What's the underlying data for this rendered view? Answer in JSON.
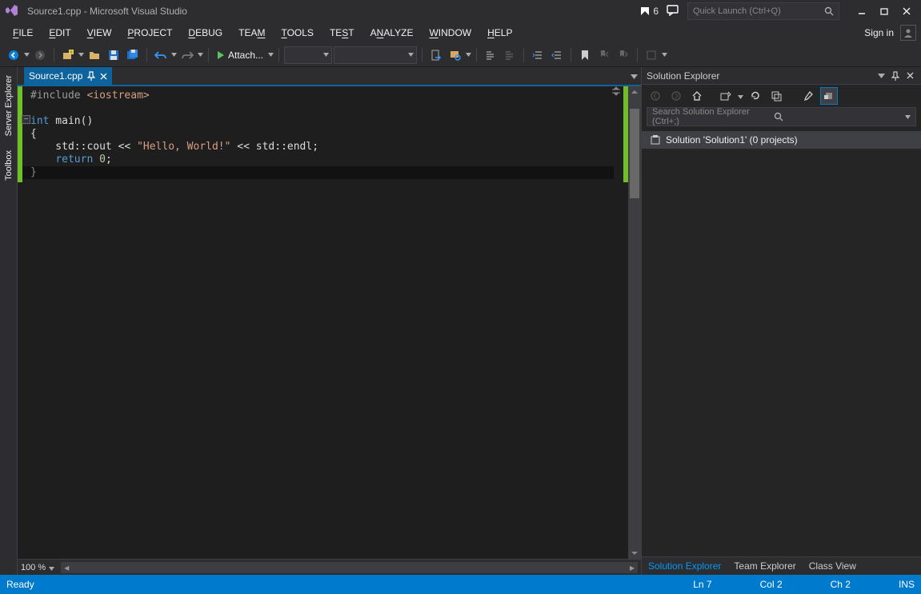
{
  "titlebar": {
    "title": "Source1.cpp - Microsoft Visual Studio",
    "notifications_count": "6",
    "quicklaunch_placeholder": "Quick Launch (Ctrl+Q)"
  },
  "menu": {
    "file": "FILE",
    "edit": "EDIT",
    "view": "VIEW",
    "project": "PROJECT",
    "debug": "DEBUG",
    "team": "TEAM",
    "tools": "TOOLS",
    "test": "TEST",
    "analyze": "ANALYZE",
    "window": "WINDOW",
    "help": "HELP",
    "signin": "Sign in"
  },
  "toolbar": {
    "attach_label": "Attach..."
  },
  "left_tabs": {
    "server_explorer": "Server Explorer",
    "toolbox": "Toolbox"
  },
  "editor": {
    "tab_label": "Source1.cpp",
    "zoom": "100 %",
    "code": {
      "l1a": "#include",
      "l1b": " <iostream>",
      "l2": "",
      "l3a": "int",
      "l3b": " main()",
      "l4": "{",
      "l5a": "    std::cout << ",
      "l5b": "\"Hello, World!\"",
      "l5c": " << std::endl;",
      "l6a": "    ",
      "l6b": "return",
      "l6c": " ",
      "l6d": "0",
      "l6e": ";",
      "l7": "}"
    }
  },
  "solution_explorer": {
    "title": "Solution Explorer",
    "search_placeholder": "Search Solution Explorer (Ctrl+;)",
    "root_label": "Solution 'Solution1' (0 projects)",
    "tabs": {
      "solution_explorer": "Solution Explorer",
      "team_explorer": "Team Explorer",
      "class_view": "Class View"
    }
  },
  "statusbar": {
    "ready": "Ready",
    "ln": "Ln 7",
    "col": "Col 2",
    "ch": "Ch 2",
    "ins": "INS"
  }
}
